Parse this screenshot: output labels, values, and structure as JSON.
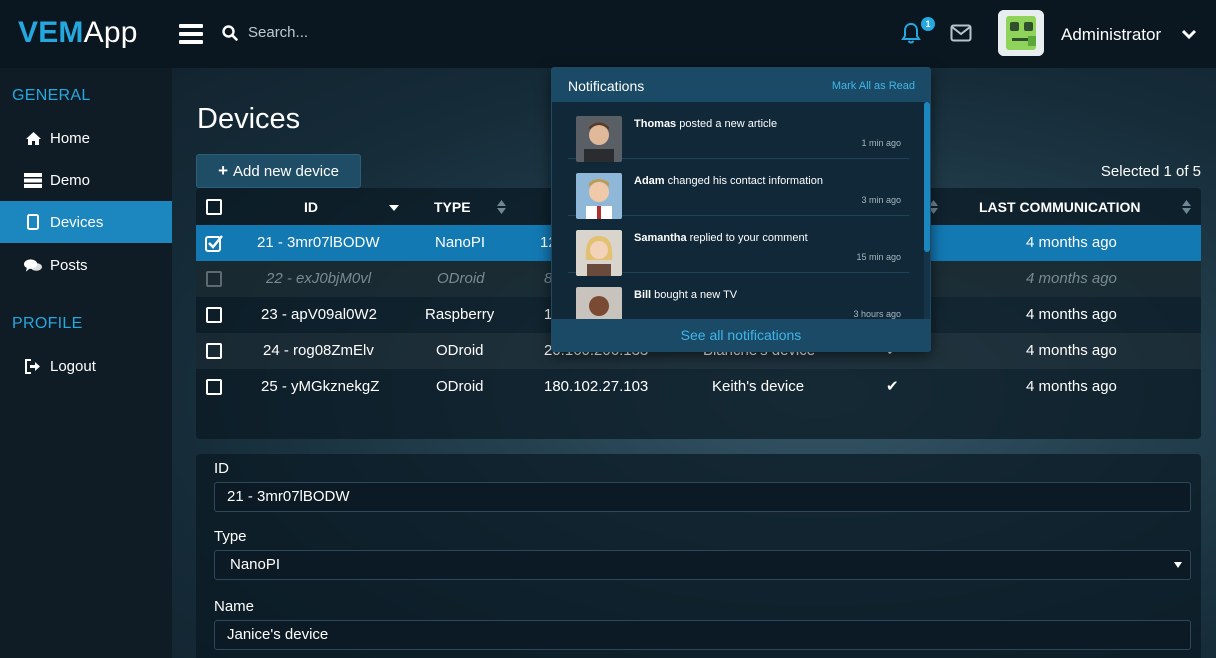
{
  "brand": {
    "part1": "VEM",
    "part2": "App"
  },
  "topbar": {
    "search_placeholder": "Search...",
    "notification_count": "1",
    "user_name": "Administrator"
  },
  "sidebar": {
    "general_heading": "GENERAL",
    "profile_heading": "PROFILE",
    "items": [
      {
        "label": "Home",
        "icon": "home-icon"
      },
      {
        "label": "Demo",
        "icon": "server-icon"
      },
      {
        "label": "Devices",
        "icon": "tablet-icon",
        "active": true
      },
      {
        "label": "Posts",
        "icon": "comments-icon"
      }
    ],
    "logout_label": "Logout"
  },
  "page": {
    "title": "Devices",
    "add_button": "Add new device",
    "selected_text": "Selected 1 of 5"
  },
  "table": {
    "columns": [
      "ID",
      "TYPE",
      "LAST COMMUNICATION"
    ],
    "rows": [
      {
        "id": "21 - 3mr07lBODW",
        "type": "NanoPI",
        "ip": "12",
        "name": "",
        "check": "",
        "last": "4 months ago",
        "state": "selected"
      },
      {
        "id": "22 - exJ0bjM0vl",
        "type": "ODroid",
        "ip": "8",
        "name": "",
        "check": "",
        "last": "4 months ago",
        "state": "disabled"
      },
      {
        "id": "23 - apV09al0W2",
        "type": "Raspberry",
        "ip": "1",
        "name": "",
        "check": "",
        "last": "4 months ago",
        "state": "normal"
      },
      {
        "id": "24 - rog08ZmElv",
        "type": "ODroid",
        "ip": "20.160.206.133",
        "name": "Blanche's device",
        "check": "✔",
        "last": "4 months ago",
        "state": "alt"
      },
      {
        "id": "25 - yMGkznekgZ",
        "type": "ODroid",
        "ip": "180.102.27.103",
        "name": "Keith's device",
        "check": "✔",
        "last": "4 months ago",
        "state": "normal"
      }
    ]
  },
  "form": {
    "id_label": "ID",
    "id_value": "21 - 3mr07lBODW",
    "type_label": "Type",
    "type_value": "NanoPI",
    "name_label": "Name",
    "name_value": "Janice's device"
  },
  "notifications": {
    "title": "Notifications",
    "mark_all": "Mark All as Read",
    "see_all": "See all notifications",
    "items": [
      {
        "user": "Thomas",
        "text": " posted a new article",
        "time": "1 min ago"
      },
      {
        "user": "Adam",
        "text": " changed his contact information",
        "time": "3 min ago"
      },
      {
        "user": "Samantha",
        "text": " replied to your comment",
        "time": "15 min ago"
      },
      {
        "user": "Bill",
        "text": " bought a new TV",
        "time": "3 hours ago"
      }
    ]
  },
  "colors": {
    "accent": "#25a8e0",
    "selected_row": "#1279b3",
    "sidebar_active": "#1c87bf"
  }
}
